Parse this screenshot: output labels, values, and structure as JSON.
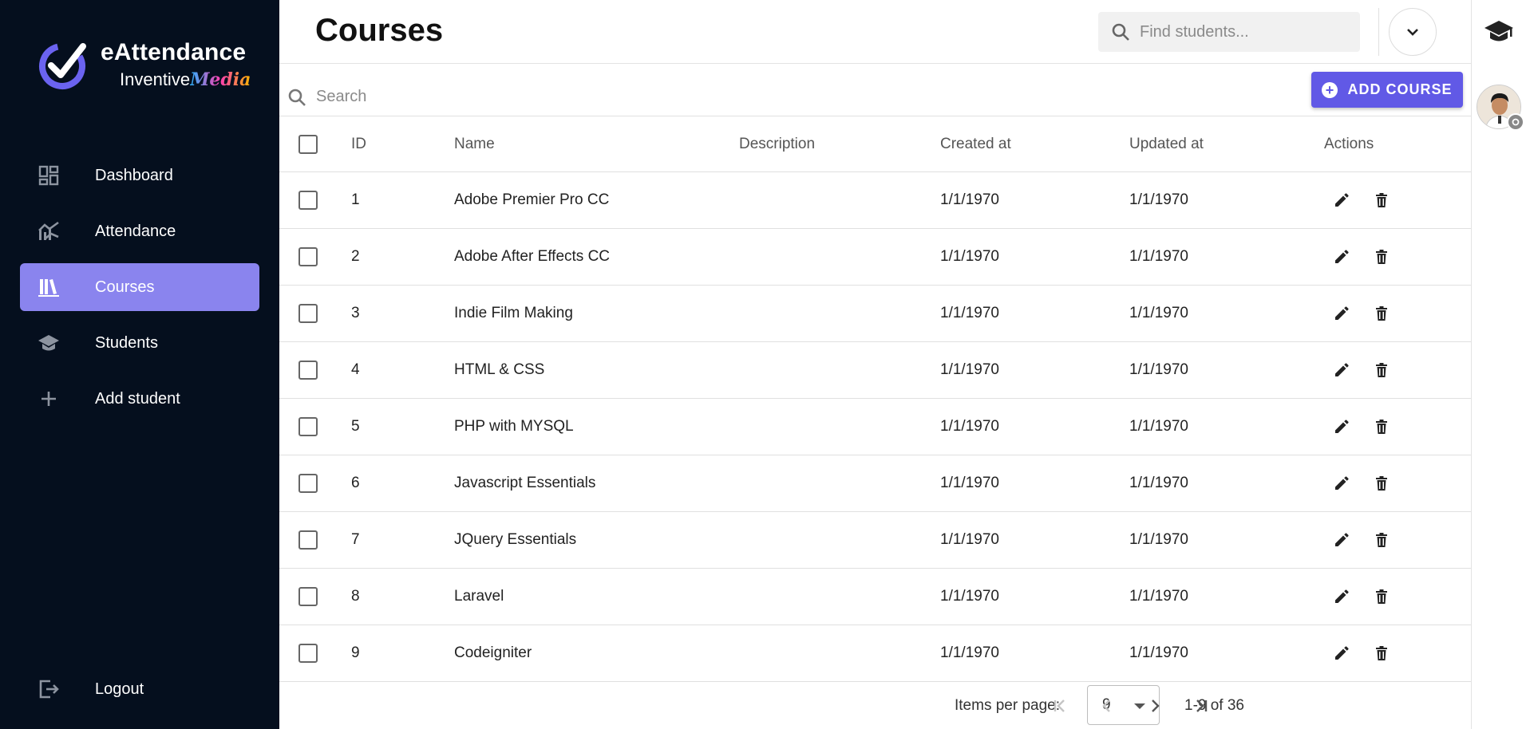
{
  "app": {
    "title": "eAttendance",
    "subtitle_prefix": "Inventive",
    "subtitle_brand": "Media"
  },
  "sidebar": {
    "items": [
      {
        "label": "Dashboard",
        "icon": "dashboard-icon",
        "active": false
      },
      {
        "label": "Attendance",
        "icon": "chart-icon",
        "active": false
      },
      {
        "label": "Courses",
        "icon": "books-icon",
        "active": true
      },
      {
        "label": "Students",
        "icon": "graduation-cap-icon",
        "active": false
      },
      {
        "label": "Add student",
        "icon": "plus-icon",
        "active": false
      }
    ],
    "logout": "Logout"
  },
  "header": {
    "title": "Courses",
    "find_placeholder": "Find students..."
  },
  "toolbar": {
    "search_placeholder": "Search",
    "add_label": "ADD COURSE"
  },
  "table": {
    "columns": [
      "ID",
      "Name",
      "Description",
      "Created at",
      "Updated at",
      "Actions"
    ],
    "rows": [
      {
        "id": "1",
        "name": "Adobe Premier Pro CC",
        "description": "",
        "created": "1/1/1970",
        "updated": "1/1/1970"
      },
      {
        "id": "2",
        "name": "Adobe After Effects CC",
        "description": "",
        "created": "1/1/1970",
        "updated": "1/1/1970"
      },
      {
        "id": "3",
        "name": "Indie Film Making",
        "description": "",
        "created": "1/1/1970",
        "updated": "1/1/1970"
      },
      {
        "id": "4",
        "name": "HTML & CSS",
        "description": "",
        "created": "1/1/1970",
        "updated": "1/1/1970"
      },
      {
        "id": "5",
        "name": "PHP with MYSQL",
        "description": "",
        "created": "1/1/1970",
        "updated": "1/1/1970"
      },
      {
        "id": "6",
        "name": "Javascript Essentials",
        "description": "",
        "created": "1/1/1970",
        "updated": "1/1/1970"
      },
      {
        "id": "7",
        "name": "JQuery Essentials",
        "description": "",
        "created": "1/1/1970",
        "updated": "1/1/1970"
      },
      {
        "id": "8",
        "name": "Laravel",
        "description": "",
        "created": "1/1/1970",
        "updated": "1/1/1970"
      },
      {
        "id": "9",
        "name": "Codeigniter",
        "description": "",
        "created": "1/1/1970",
        "updated": "1/1/1970"
      }
    ]
  },
  "pagination": {
    "items_per_page_label": "Items per page:",
    "items_per_page": "9",
    "range": "1-9 of 36"
  },
  "colors": {
    "sidebar_bg": "#050f1e",
    "active_item": "#8a84ee",
    "primary": "#6159e6"
  }
}
